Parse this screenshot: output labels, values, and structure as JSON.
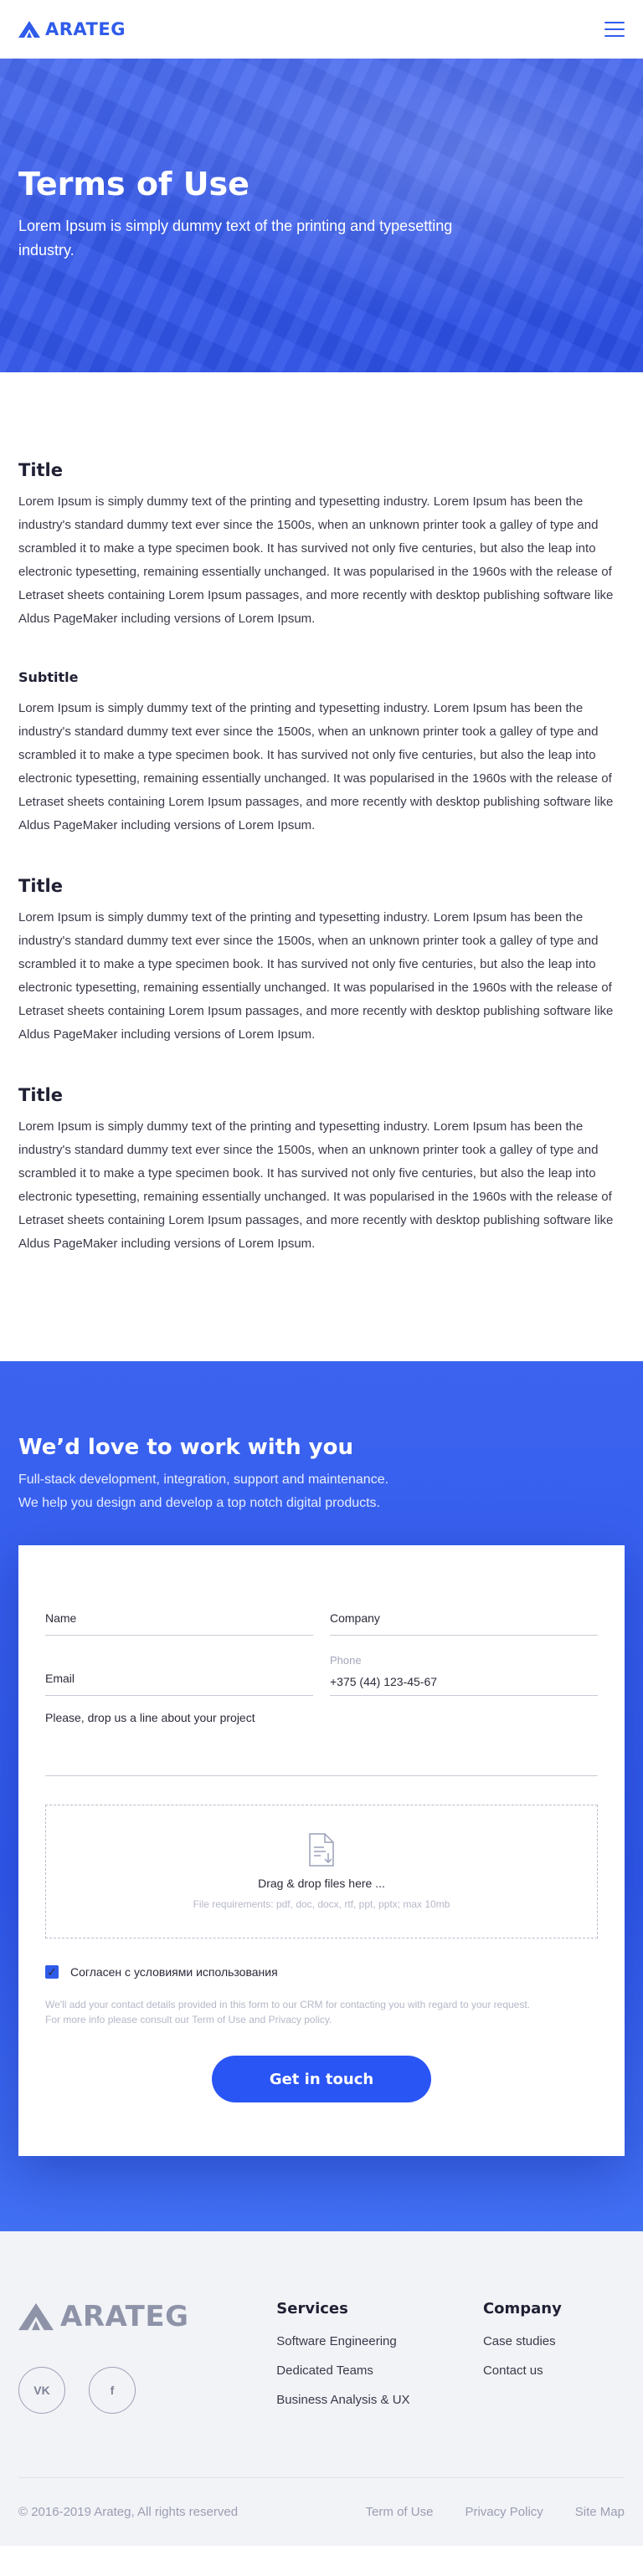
{
  "header": {
    "brand": "ARATEG"
  },
  "hero": {
    "title": "Terms of Use",
    "subtitle": "Lorem Ipsum is simply dummy text of the printing and typesetting industry."
  },
  "sections": [
    {
      "heading": "Title",
      "body": "Lorem Ipsum is simply dummy text of the printing and typesetting industry. Lorem Ipsum has been the industry's standard dummy text ever since the 1500s, when an unknown printer took a galley of type and scrambled it to make a type specimen book. It has survived not only five centuries, but also the leap into electronic typesetting, remaining essentially unchanged. It was popularised in the 1960s with the release of Letraset sheets containing Lorem Ipsum passages, and more recently with desktop publishing software like Aldus PageMaker including versions of Lorem Ipsum."
    },
    {
      "heading": "Subtitle",
      "body": "Lorem Ipsum is simply dummy text of the printing and typesetting industry. Lorem Ipsum has been the industry's standard dummy text ever since the 1500s, when an unknown printer took a galley of type and scrambled it to make a type specimen book. It has survived not only five centuries, but also the leap into electronic typesetting, remaining essentially unchanged. It was popularised in the 1960s with the release of Letraset sheets containing Lorem Ipsum passages, and more recently with desktop publishing software like Aldus PageMaker including versions of Lorem Ipsum."
    },
    {
      "heading": "Title",
      "body": "Lorem Ipsum is simply dummy text of the printing and typesetting industry. Lorem Ipsum has been the industry's standard dummy text ever since the 1500s, when an unknown printer took a galley of type and scrambled it to make a type specimen book. It has survived not only five centuries, but also the leap into electronic typesetting, remaining essentially unchanged. It was popularised in the 1960s with the release of Letraset sheets containing Lorem Ipsum passages, and more recently with desktop publishing software like Aldus PageMaker including versions of Lorem Ipsum."
    },
    {
      "heading": "Title",
      "body": "Lorem Ipsum is simply dummy text of the printing and typesetting industry. Lorem Ipsum has been the industry's standard dummy text ever since the 1500s, when an unknown printer took a galley of type and scrambled it to make a type specimen book. It has survived not only five centuries, but also the leap into electronic typesetting, remaining essentially unchanged. It was popularised in the 1960s with the release of Letraset sheets containing Lorem Ipsum passages, and more recently with desktop publishing software like Aldus PageMaker including versions of Lorem Ipsum."
    }
  ],
  "contact": {
    "title": "We’d love to work with you",
    "line1": "Full-stack development, integration, support and maintenance.",
    "line2": "We help you design and develop a top notch digital products.",
    "form": {
      "name_label": "Name",
      "company_label": "Company",
      "email_label": "Email",
      "phone_label": "Phone",
      "phone_value": "+375 (44) 123-45-67",
      "message_label": "Please, drop us a line about your project",
      "drop_title": "Drag & drop files here ...",
      "drop_requirements": "File requirements: pdf, doc, docx, rtf, ppt, pptx; max 10mb",
      "consent_label": "Согласен с условиями использования",
      "note_line1": "We'll add your contact details provided in this form to our CRM for contacting you with regard to your request.",
      "note_line2": "For more info please consult our Term of Use and Privacy policy.",
      "submit_label": "Get in touch"
    }
  },
  "footer": {
    "brand": "ARATEG",
    "socials": {
      "vk": "VK",
      "facebook": "f"
    },
    "services": {
      "heading": "Services",
      "items": [
        "Software Engineering",
        "Dedicated Teams",
        "Business Analysis & UX"
      ]
    },
    "company": {
      "heading": "Company",
      "items": [
        "Case studies",
        "Contact us"
      ]
    },
    "copyright": "© 2016-2019 Arateg, All rights reserved",
    "links": [
      "Term of Use",
      "Privacy Policy",
      "Site Map"
    ]
  },
  "colors": {
    "brand": "#2f5bea",
    "cta": "#2a55f5",
    "footer_bg": "#f2f3f7"
  },
  "icons": {
    "logo": "arateg-triangle-logo",
    "menu": "hamburger-icon",
    "file": "file-upload-icon",
    "check": "checkmark-icon"
  }
}
